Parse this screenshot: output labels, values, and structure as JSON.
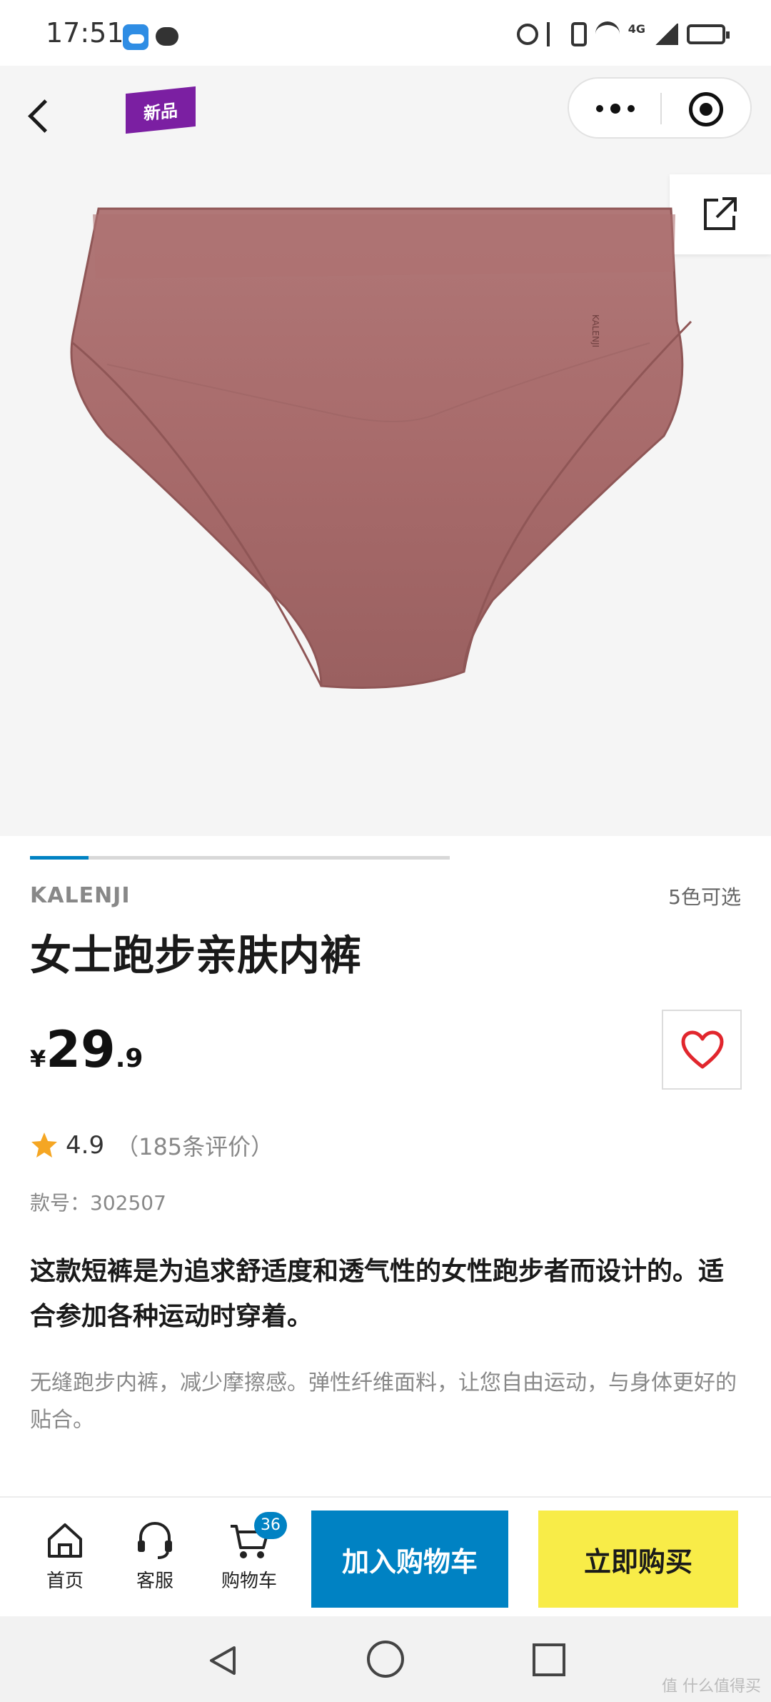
{
  "status_bar": {
    "time": "17:51",
    "network": "4G"
  },
  "header": {
    "new_badge": "新品"
  },
  "carousel": {
    "progress": 0.14
  },
  "product": {
    "brand": "KALENJI",
    "color_options": "5色可选",
    "title": "女士跑步亲肤内裤",
    "garment_label": "KALENJI",
    "price": {
      "currency": "¥",
      "integer": "29",
      "decimal": ".9"
    },
    "rating": "4.9",
    "review_count": "（185条评价）",
    "model_number": "款号：302507",
    "description_main": "这款短裤是为追求舒适度和透气性的女性跑步者而设计的。适合参加各种运动时穿着。",
    "description_sub": "无缝跑步内裤，减少摩擦感。弹性纤维面料，让您自由运动，与身体更好的贴合。"
  },
  "bottom_bar": {
    "home_label": "首页",
    "service_label": "客服",
    "cart_label": "购物车",
    "cart_count": "36",
    "add_to_cart": "加入购物车",
    "buy_now": "立即购买"
  },
  "watermark": "值 什么值得买",
  "colors": {
    "accent_blue": "#0082c3",
    "buy_yellow": "#f8ec48",
    "badge_purple": "#7b1fa2",
    "heart_red": "#e1262d",
    "product_mauve": "#a86b6b"
  }
}
